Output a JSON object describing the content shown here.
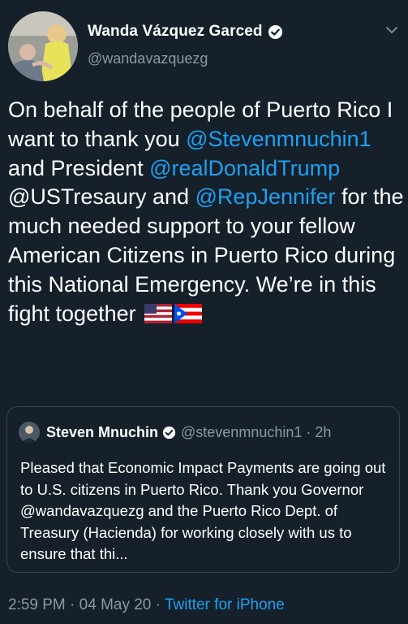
{
  "author": {
    "display_name": "Wanda Vázquez Garced",
    "handle": "@wandavazquezg"
  },
  "tweet": {
    "t1": "On behalf of the people of Puerto Rico I want to thank you ",
    "m1": "@Stevenmnuchin1",
    "t2": " and President ",
    "m2": "@realDonaldTrump",
    "t3": " @USTresaury and ",
    "m3": "@RepJennifer",
    "t4": " for the much needed support to your fellow American Citizens in Puerto Rico during this National Emergency. We’re in this fight together "
  },
  "quoted": {
    "display_name": "Steven Mnuchin",
    "handle": "@stevenmnuchin1",
    "separator": "·",
    "time": "2h",
    "text": "Pleased that Economic Impact Payments are going out to U.S. citizens in Puerto Rico. Thank you Governor @wandavazquezg and the Puerto Rico Dept. of Treasury (Hacienda) for working closely with us to ensure that thi..."
  },
  "meta": {
    "time": "2:59 PM",
    "separator1": "·",
    "date": "04 May 20",
    "separator2": "·",
    "source": "Twitter for iPhone"
  },
  "icons": {
    "verified": "verified-badge-icon",
    "caret": "chevron-down-icon",
    "flags": [
      "us-flag-icon",
      "puerto-rico-flag-icon"
    ]
  },
  "colors": {
    "background": "#15202b",
    "text": "#ffffff",
    "secondary": "#8899a6",
    "link": "#1da1f2",
    "border": "#38444d"
  }
}
